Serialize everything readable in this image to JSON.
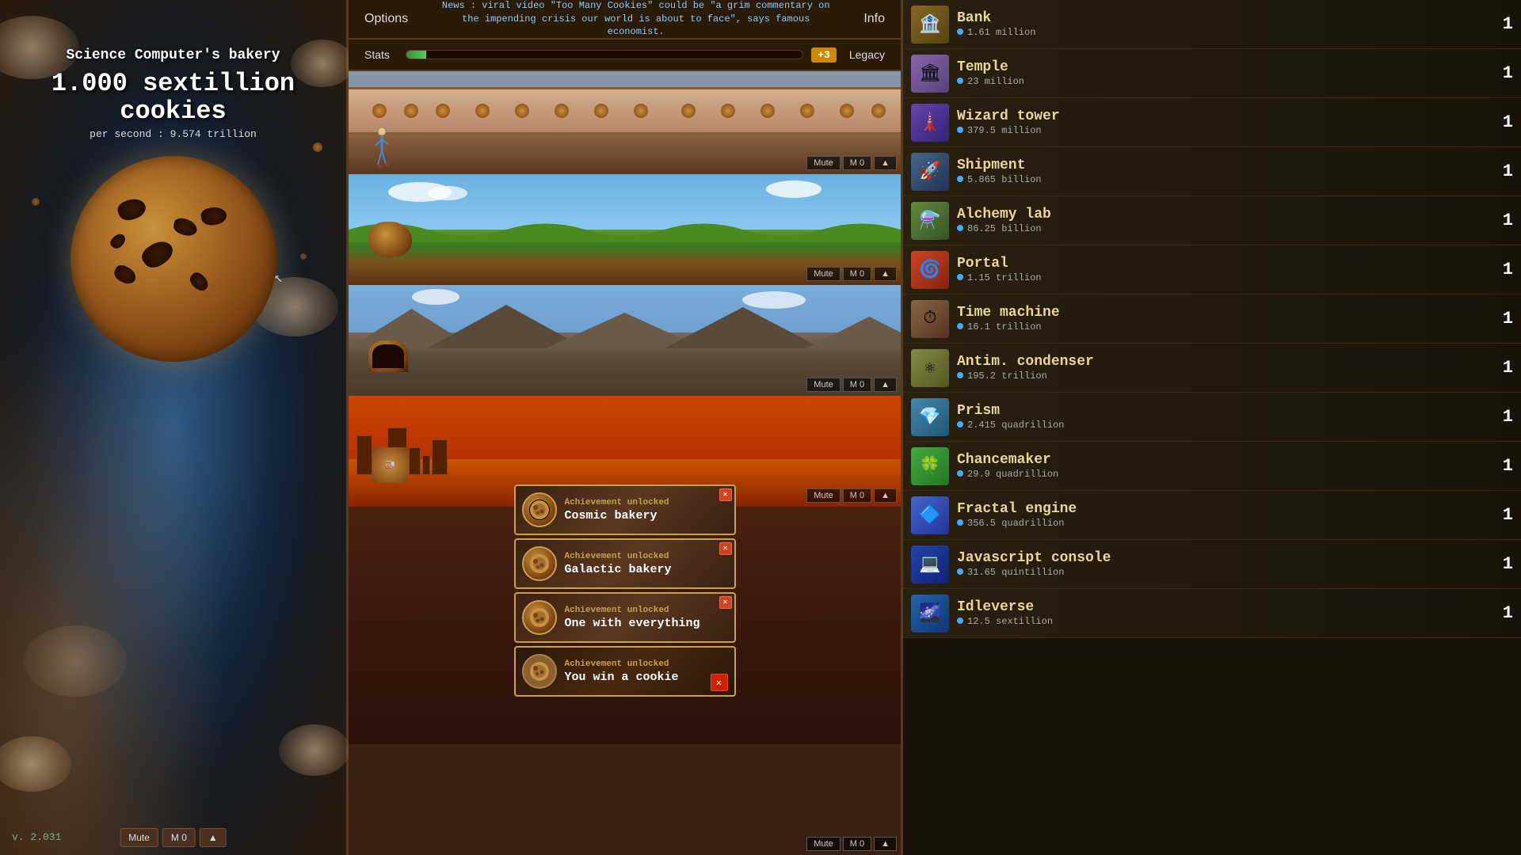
{
  "left": {
    "bakery_name": "Science Computer's bakery",
    "cookie_count": "1.000 sextillion",
    "cookie_unit": "cookies",
    "per_second_label": "per second : 9.574 trillion",
    "version": "v. 2.031"
  },
  "top_bar": {
    "options_label": "Options",
    "info_label": "Info",
    "news_text": "News : viral video \"Too Many Cookies\" could be \"a grim commentary on the impending crisis our world is about to face\", says famous economist."
  },
  "stats_bar": {
    "stats_label": "Stats",
    "legacy_label": "Legacy",
    "legacy_badge": "+3"
  },
  "bottom_controls": {
    "mute_label": "Mute",
    "m0_label": "M 0"
  },
  "achievements": [
    {
      "id": "cosmic",
      "unlocked_label": "Achievement unlocked",
      "name": "Cosmic bakery"
    },
    {
      "id": "galactic",
      "unlocked_label": "Achievement unlocked",
      "name": "Galactic bakery"
    },
    {
      "id": "onewith",
      "unlocked_label": "Achievement unlocked",
      "name": "One with everything"
    },
    {
      "id": "cookie",
      "unlocked_label": "Achievement unlocked",
      "name": "You win a cookie"
    }
  ],
  "buildings": [
    {
      "name": "Bank",
      "cost": "1.61 million",
      "count": "1",
      "icon_class": "icon-bank",
      "icon_emoji": "🏦"
    },
    {
      "name": "Temple",
      "cost": "23 million",
      "count": "1",
      "icon_class": "icon-temple",
      "icon_emoji": "🏛"
    },
    {
      "name": "Wizard tower",
      "cost": "379.5 million",
      "count": "1",
      "icon_class": "icon-wizard",
      "icon_emoji": "🗼"
    },
    {
      "name": "Shipment",
      "cost": "5.865 billion",
      "count": "1",
      "icon_class": "icon-shipment",
      "icon_emoji": "🚀"
    },
    {
      "name": "Alchemy lab",
      "cost": "86.25 billion",
      "count": "1",
      "icon_class": "icon-alchemy",
      "icon_emoji": "⚗️"
    },
    {
      "name": "Portal",
      "cost": "1.15 trillion",
      "count": "1",
      "icon_class": "icon-portal",
      "icon_emoji": "🌀"
    },
    {
      "name": "Time machine",
      "cost": "16.1 trillion",
      "count": "1",
      "icon_class": "icon-time",
      "icon_emoji": "⏱"
    },
    {
      "name": "Antim. condenser",
      "cost": "195.2 trillion",
      "count": "1",
      "icon_class": "icon-antim",
      "icon_emoji": "⚛"
    },
    {
      "name": "Prism",
      "cost": "2.415 quadrillion",
      "count": "1",
      "icon_class": "icon-prism",
      "icon_emoji": "💎"
    },
    {
      "name": "Chancemaker",
      "cost": "29.9 quadrillion",
      "count": "1",
      "icon_class": "icon-chance",
      "icon_emoji": "🍀"
    },
    {
      "name": "Fractal engine",
      "cost": "356.5 quadrillion",
      "count": "1",
      "icon_class": "icon-fractal",
      "icon_emoji": "🔷"
    },
    {
      "name": "Javascript console",
      "cost": "31.65 quintillion",
      "count": "1",
      "icon_class": "icon-js",
      "icon_emoji": "💻"
    },
    {
      "name": "Idleverse",
      "cost": "12.5 sextillion",
      "count": "1",
      "icon_class": "icon-idle",
      "icon_emoji": "🌌"
    }
  ]
}
